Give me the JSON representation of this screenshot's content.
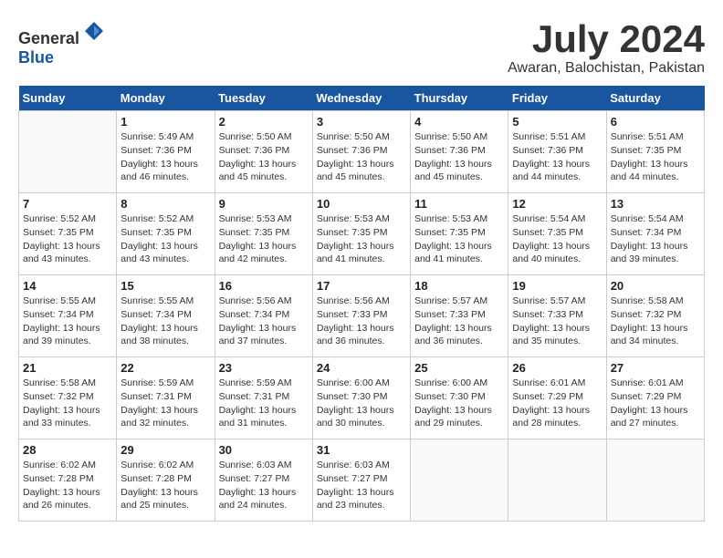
{
  "header": {
    "logo_general": "General",
    "logo_blue": "Blue",
    "month": "July 2024",
    "location": "Awaran, Balochistan, Pakistan"
  },
  "weekdays": [
    "Sunday",
    "Monday",
    "Tuesday",
    "Wednesday",
    "Thursday",
    "Friday",
    "Saturday"
  ],
  "weeks": [
    [
      {
        "day": "",
        "info": ""
      },
      {
        "day": "1",
        "info": "Sunrise: 5:49 AM\nSunset: 7:36 PM\nDaylight: 13 hours\nand 46 minutes."
      },
      {
        "day": "2",
        "info": "Sunrise: 5:50 AM\nSunset: 7:36 PM\nDaylight: 13 hours\nand 45 minutes."
      },
      {
        "day": "3",
        "info": "Sunrise: 5:50 AM\nSunset: 7:36 PM\nDaylight: 13 hours\nand 45 minutes."
      },
      {
        "day": "4",
        "info": "Sunrise: 5:50 AM\nSunset: 7:36 PM\nDaylight: 13 hours\nand 45 minutes."
      },
      {
        "day": "5",
        "info": "Sunrise: 5:51 AM\nSunset: 7:36 PM\nDaylight: 13 hours\nand 44 minutes."
      },
      {
        "day": "6",
        "info": "Sunrise: 5:51 AM\nSunset: 7:35 PM\nDaylight: 13 hours\nand 44 minutes."
      }
    ],
    [
      {
        "day": "7",
        "info": "Sunrise: 5:52 AM\nSunset: 7:35 PM\nDaylight: 13 hours\nand 43 minutes."
      },
      {
        "day": "8",
        "info": "Sunrise: 5:52 AM\nSunset: 7:35 PM\nDaylight: 13 hours\nand 43 minutes."
      },
      {
        "day": "9",
        "info": "Sunrise: 5:53 AM\nSunset: 7:35 PM\nDaylight: 13 hours\nand 42 minutes."
      },
      {
        "day": "10",
        "info": "Sunrise: 5:53 AM\nSunset: 7:35 PM\nDaylight: 13 hours\nand 41 minutes."
      },
      {
        "day": "11",
        "info": "Sunrise: 5:53 AM\nSunset: 7:35 PM\nDaylight: 13 hours\nand 41 minutes."
      },
      {
        "day": "12",
        "info": "Sunrise: 5:54 AM\nSunset: 7:35 PM\nDaylight: 13 hours\nand 40 minutes."
      },
      {
        "day": "13",
        "info": "Sunrise: 5:54 AM\nSunset: 7:34 PM\nDaylight: 13 hours\nand 39 minutes."
      }
    ],
    [
      {
        "day": "14",
        "info": "Sunrise: 5:55 AM\nSunset: 7:34 PM\nDaylight: 13 hours\nand 39 minutes."
      },
      {
        "day": "15",
        "info": "Sunrise: 5:55 AM\nSunset: 7:34 PM\nDaylight: 13 hours\nand 38 minutes."
      },
      {
        "day": "16",
        "info": "Sunrise: 5:56 AM\nSunset: 7:34 PM\nDaylight: 13 hours\nand 37 minutes."
      },
      {
        "day": "17",
        "info": "Sunrise: 5:56 AM\nSunset: 7:33 PM\nDaylight: 13 hours\nand 36 minutes."
      },
      {
        "day": "18",
        "info": "Sunrise: 5:57 AM\nSunset: 7:33 PM\nDaylight: 13 hours\nand 36 minutes."
      },
      {
        "day": "19",
        "info": "Sunrise: 5:57 AM\nSunset: 7:33 PM\nDaylight: 13 hours\nand 35 minutes."
      },
      {
        "day": "20",
        "info": "Sunrise: 5:58 AM\nSunset: 7:32 PM\nDaylight: 13 hours\nand 34 minutes."
      }
    ],
    [
      {
        "day": "21",
        "info": "Sunrise: 5:58 AM\nSunset: 7:32 PM\nDaylight: 13 hours\nand 33 minutes."
      },
      {
        "day": "22",
        "info": "Sunrise: 5:59 AM\nSunset: 7:31 PM\nDaylight: 13 hours\nand 32 minutes."
      },
      {
        "day": "23",
        "info": "Sunrise: 5:59 AM\nSunset: 7:31 PM\nDaylight: 13 hours\nand 31 minutes."
      },
      {
        "day": "24",
        "info": "Sunrise: 6:00 AM\nSunset: 7:30 PM\nDaylight: 13 hours\nand 30 minutes."
      },
      {
        "day": "25",
        "info": "Sunrise: 6:00 AM\nSunset: 7:30 PM\nDaylight: 13 hours\nand 29 minutes."
      },
      {
        "day": "26",
        "info": "Sunrise: 6:01 AM\nSunset: 7:29 PM\nDaylight: 13 hours\nand 28 minutes."
      },
      {
        "day": "27",
        "info": "Sunrise: 6:01 AM\nSunset: 7:29 PM\nDaylight: 13 hours\nand 27 minutes."
      }
    ],
    [
      {
        "day": "28",
        "info": "Sunrise: 6:02 AM\nSunset: 7:28 PM\nDaylight: 13 hours\nand 26 minutes."
      },
      {
        "day": "29",
        "info": "Sunrise: 6:02 AM\nSunset: 7:28 PM\nDaylight: 13 hours\nand 25 minutes."
      },
      {
        "day": "30",
        "info": "Sunrise: 6:03 AM\nSunset: 7:27 PM\nDaylight: 13 hours\nand 24 minutes."
      },
      {
        "day": "31",
        "info": "Sunrise: 6:03 AM\nSunset: 7:27 PM\nDaylight: 13 hours\nand 23 minutes."
      },
      {
        "day": "",
        "info": ""
      },
      {
        "day": "",
        "info": ""
      },
      {
        "day": "",
        "info": ""
      }
    ]
  ]
}
